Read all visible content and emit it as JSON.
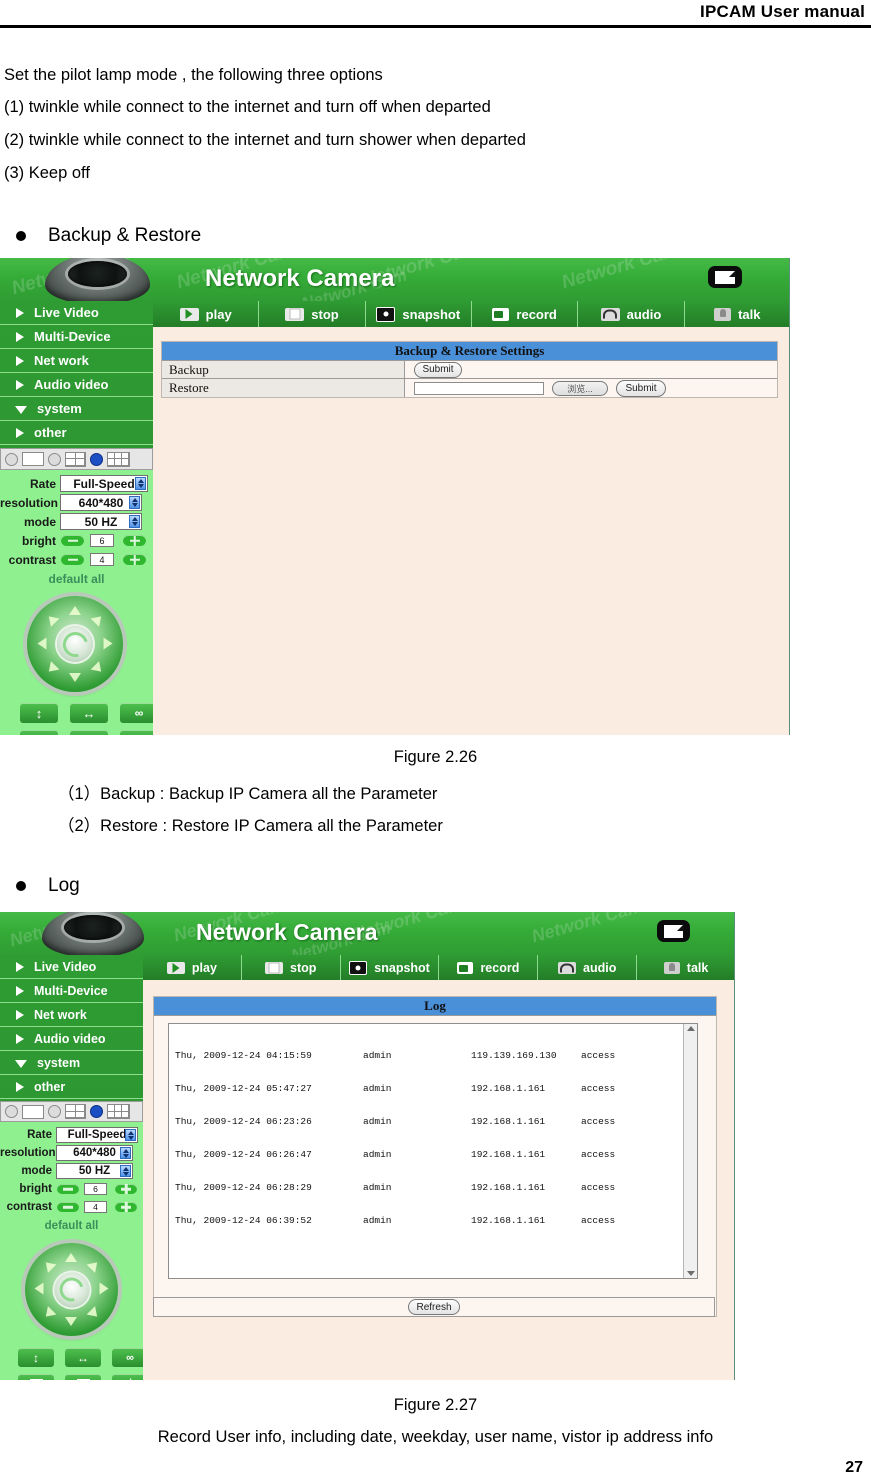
{
  "header": {
    "title": "IPCAM User manual"
  },
  "intro": {
    "line1": "Set the pilot lamp mode , the following three options",
    "line2": "(1) twinkle while connect to the internet and turn off when departed",
    "line3": "(2) twinkle while connect to the internet and turn shower when departed",
    "line4": "(3) Keep off"
  },
  "sections": {
    "backup_restore_heading": "Backup & Restore",
    "log_heading": "Log"
  },
  "figure_226": {
    "caption": "Figure 2.26",
    "note1": "（1）Backup : Backup IP Camera all the Parameter",
    "note2": "（2）Restore : Restore IP Camera all the Parameter"
  },
  "figure_227": {
    "caption": "Figure 2.27",
    "note": "Record User info, including date, weekday, user name, vistor ip address info"
  },
  "page_number": "27",
  "ui": {
    "brand": "Network Camera",
    "watermark": "Network Cam",
    "toolbar": [
      {
        "label": "play",
        "icon": "play-icon"
      },
      {
        "label": "stop",
        "icon": "stop-icon"
      },
      {
        "label": "snapshot",
        "icon": "snapshot-icon"
      },
      {
        "label": "record",
        "icon": "record-icon"
      },
      {
        "label": "audio",
        "icon": "audio-icon"
      },
      {
        "label": "talk",
        "icon": "talk-icon"
      }
    ],
    "nav": [
      {
        "label": "Live Video",
        "state": "collapsed"
      },
      {
        "label": "Multi-Device",
        "state": "collapsed"
      },
      {
        "label": "Net work",
        "state": "collapsed"
      },
      {
        "label": "Audio video",
        "state": "collapsed"
      },
      {
        "label": "system",
        "state": "expanded"
      },
      {
        "label": "other",
        "state": "collapsed"
      }
    ],
    "settings": {
      "rate_label": "Rate",
      "rate_value": "Full-Speed",
      "resolution_label": "resolution",
      "resolution_value": "640*480",
      "mode_label": "mode",
      "mode_value": "50 HZ",
      "bright_label": "bright",
      "bright_value": "6",
      "contrast_label": "contrast",
      "contrast_value": "4",
      "default_all": "default all"
    }
  },
  "backup_panel": {
    "title": "Backup & Restore Settings",
    "rows": [
      {
        "label": "Backup",
        "submit": "Submit"
      },
      {
        "label": "Restore",
        "submit": "Submit",
        "file_value": "",
        "browse": "浏览..."
      }
    ]
  },
  "log_panel": {
    "title": "Log",
    "refresh": "Refresh",
    "entries": [
      {
        "date": "Thu, 2009-12-24 04:15:59",
        "user": "admin",
        "ip": "119.139.169.130",
        "action": "access"
      },
      {
        "date": "Thu, 2009-12-24 05:47:27",
        "user": "admin",
        "ip": "192.168.1.161",
        "action": "access"
      },
      {
        "date": "Thu, 2009-12-24 06:23:26",
        "user": "admin",
        "ip": "192.168.1.161",
        "action": "access"
      },
      {
        "date": "Thu, 2009-12-24 06:26:47",
        "user": "admin",
        "ip": "192.168.1.161",
        "action": "access"
      },
      {
        "date": "Thu, 2009-12-24 06:28:29",
        "user": "admin",
        "ip": "192.168.1.161",
        "action": "access"
      },
      {
        "date": "Thu, 2009-12-24 06:39:52",
        "user": "admin",
        "ip": "192.168.1.161",
        "action": "access"
      }
    ]
  },
  "colors": {
    "nav_green": "#2f9c33",
    "panel_blue": "#4a90d9",
    "content_cream": "#fbece1",
    "ctrl_green": "#8ef08e"
  }
}
